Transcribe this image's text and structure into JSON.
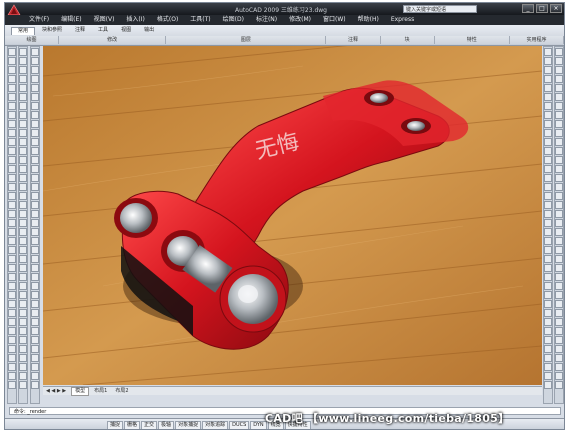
{
  "window": {
    "title": "AutoCAD 2009 三维练习23.dwg",
    "controls": [
      "_",
      "□",
      "×"
    ]
  },
  "search": {
    "placeholder": "键入关键字或短语"
  },
  "menu": [
    "文件(F)",
    "编辑(E)",
    "视图(V)",
    "插入(I)",
    "格式(O)",
    "工具(T)",
    "绘图(D)",
    "标注(N)",
    "修改(M)",
    "窗口(W)",
    "帮助(H)",
    "Express"
  ],
  "ribbon": {
    "tabs": [
      "常用",
      "块和参照",
      "注释",
      "工具",
      "视图",
      "输出"
    ],
    "panels": [
      "绘图",
      "修改",
      "图层",
      "注释",
      "块",
      "特性",
      "实用程序"
    ]
  },
  "model": {
    "engraved_text": "无悔"
  },
  "layout_tabs": [
    "模型",
    "布局1",
    "布局2"
  ],
  "command": {
    "text": "命令: _render"
  },
  "status": {
    "buttons": [
      "捕捉",
      "栅格",
      "正交",
      "极轴",
      "对象捕捉",
      "对象追踪",
      "DUCS",
      "DYN",
      "线宽",
      "快捷特性"
    ]
  },
  "watermark": "CAD吧 【www.lineeg.com/tieba/1805】",
  "colors": {
    "part_red": "#d4141e",
    "floor_wood": "#c98a3a",
    "chrome": "#cfd3d6"
  }
}
